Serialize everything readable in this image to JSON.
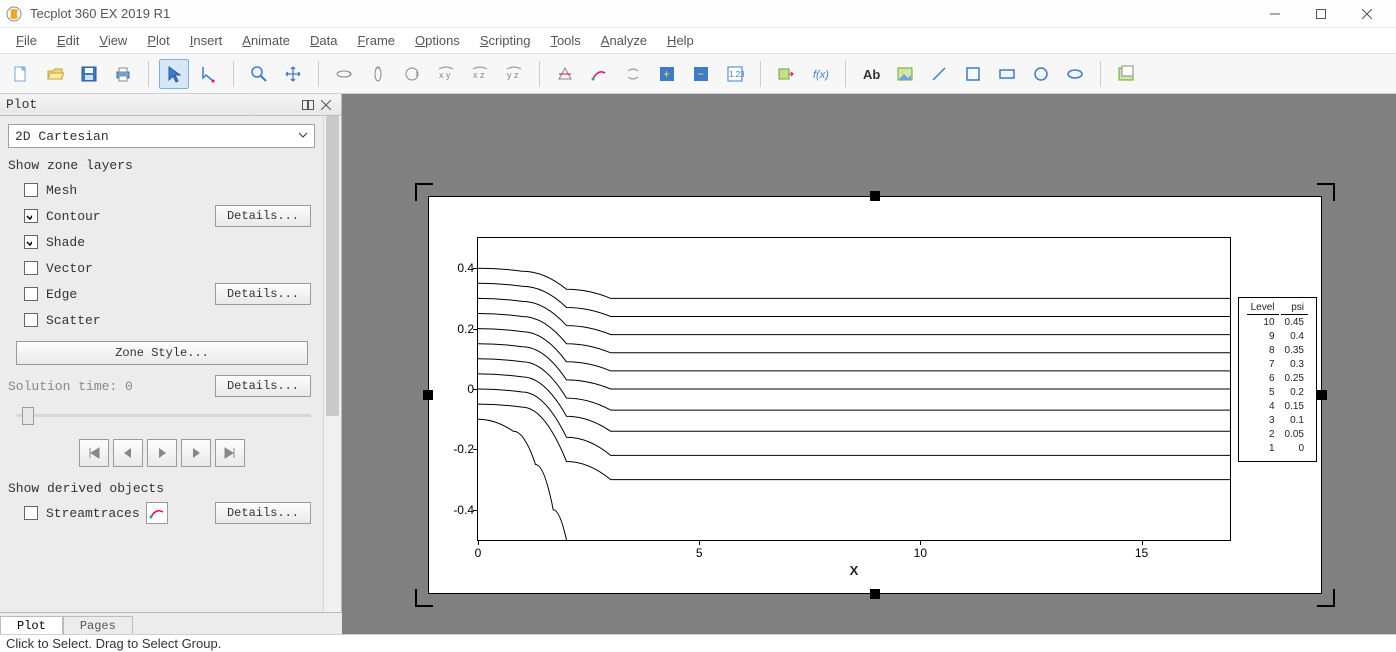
{
  "window": {
    "title": "Tecplot 360 EX 2019 R1"
  },
  "menus": [
    "File",
    "Edit",
    "View",
    "Plot",
    "Insert",
    "Animate",
    "Data",
    "Frame",
    "Options",
    "Scripting",
    "Tools",
    "Analyze",
    "Help"
  ],
  "panel": {
    "title": "Plot",
    "plot_type": "2D Cartesian",
    "show_zone_layers_label": "Show zone layers",
    "layers": {
      "mesh": {
        "label": "Mesh",
        "checked": false
      },
      "contour": {
        "label": "Contour",
        "checked": true,
        "details": "Details..."
      },
      "shade": {
        "label": "Shade",
        "checked": true
      },
      "vector": {
        "label": "Vector",
        "checked": false
      },
      "edge": {
        "label": "Edge",
        "checked": false,
        "details": "Details..."
      },
      "scatter": {
        "label": "Scatter",
        "checked": false
      }
    },
    "zone_style_btn": "Zone Style...",
    "solution_time_label": "Solution time: 0",
    "solution_details": "Details...",
    "show_derived_objects_label": "Show derived objects",
    "streamtraces": {
      "label": "Streamtraces",
      "checked": false,
      "details": "Details..."
    },
    "tabs": {
      "plot": "Plot",
      "pages": "Pages"
    }
  },
  "statusbar": "Click to Select. Drag to Select Group.",
  "chart_data": {
    "type": "line",
    "xlabel": "X",
    "ylabel": "",
    "xlim": [
      0,
      17
    ],
    "ylim": [
      -0.5,
      0.5
    ],
    "xticks": [
      0,
      5,
      10,
      15
    ],
    "yticks": [
      -0.4,
      -0.2,
      0,
      0.2,
      0.4
    ],
    "legend_title": [
      "Level",
      "psi"
    ],
    "levels": [
      {
        "level": 10,
        "psi": 0.45
      },
      {
        "level": 9,
        "psi": 0.4
      },
      {
        "level": 8,
        "psi": 0.35
      },
      {
        "level": 7,
        "psi": 0.3
      },
      {
        "level": 6,
        "psi": 0.25
      },
      {
        "level": 5,
        "psi": 0.2
      },
      {
        "level": 4,
        "psi": 0.15
      },
      {
        "level": 3,
        "psi": 0.1
      },
      {
        "level": 2,
        "psi": 0.05
      },
      {
        "level": 1,
        "psi": 0
      }
    ],
    "contours": [
      {
        "psi": 0.45,
        "x": [
          0,
          1,
          2,
          3,
          5,
          17
        ],
        "y": [
          0.4,
          0.39,
          0.33,
          0.3,
          0.3,
          0.3
        ]
      },
      {
        "psi": 0.4,
        "x": [
          0,
          1,
          2,
          3,
          5,
          17
        ],
        "y": [
          0.35,
          0.34,
          0.27,
          0.24,
          0.24,
          0.24
        ]
      },
      {
        "psi": 0.35,
        "x": [
          0,
          1,
          2,
          3,
          5,
          17
        ],
        "y": [
          0.3,
          0.29,
          0.21,
          0.18,
          0.18,
          0.18
        ]
      },
      {
        "psi": 0.3,
        "x": [
          0,
          1,
          2,
          3,
          5,
          17
        ],
        "y": [
          0.25,
          0.24,
          0.15,
          0.12,
          0.12,
          0.12
        ]
      },
      {
        "psi": 0.25,
        "x": [
          0,
          1,
          2,
          3,
          5,
          17
        ],
        "y": [
          0.2,
          0.19,
          0.09,
          0.06,
          0.06,
          0.06
        ]
      },
      {
        "psi": 0.2,
        "x": [
          0,
          1,
          2,
          3,
          5,
          17
        ],
        "y": [
          0.15,
          0.14,
          0.03,
          0.0,
          0.0,
          0.0
        ]
      },
      {
        "psi": 0.15,
        "x": [
          0,
          1,
          2,
          3,
          5,
          17
        ],
        "y": [
          0.1,
          0.09,
          -0.03,
          -0.07,
          -0.07,
          -0.07
        ]
      },
      {
        "psi": 0.1,
        "x": [
          0,
          1,
          2,
          3,
          5,
          17
        ],
        "y": [
          0.05,
          0.04,
          -0.09,
          -0.14,
          -0.14,
          -0.14
        ]
      },
      {
        "psi": 0.05,
        "x": [
          0,
          1,
          2,
          3,
          5,
          17
        ],
        "y": [
          0.0,
          -0.01,
          -0.16,
          -0.22,
          -0.22,
          -0.22
        ]
      },
      {
        "psi": 0.0,
        "x": [
          0,
          1,
          2,
          3,
          5,
          17
        ],
        "y": [
          -0.05,
          -0.06,
          -0.24,
          -0.3,
          -0.3,
          -0.3
        ]
      },
      {
        "psi": -0.05,
        "x": [
          0,
          0.8,
          1.3,
          1.7,
          2.0
        ],
        "y": [
          -0.1,
          -0.14,
          -0.25,
          -0.4,
          -0.5
        ]
      }
    ]
  }
}
